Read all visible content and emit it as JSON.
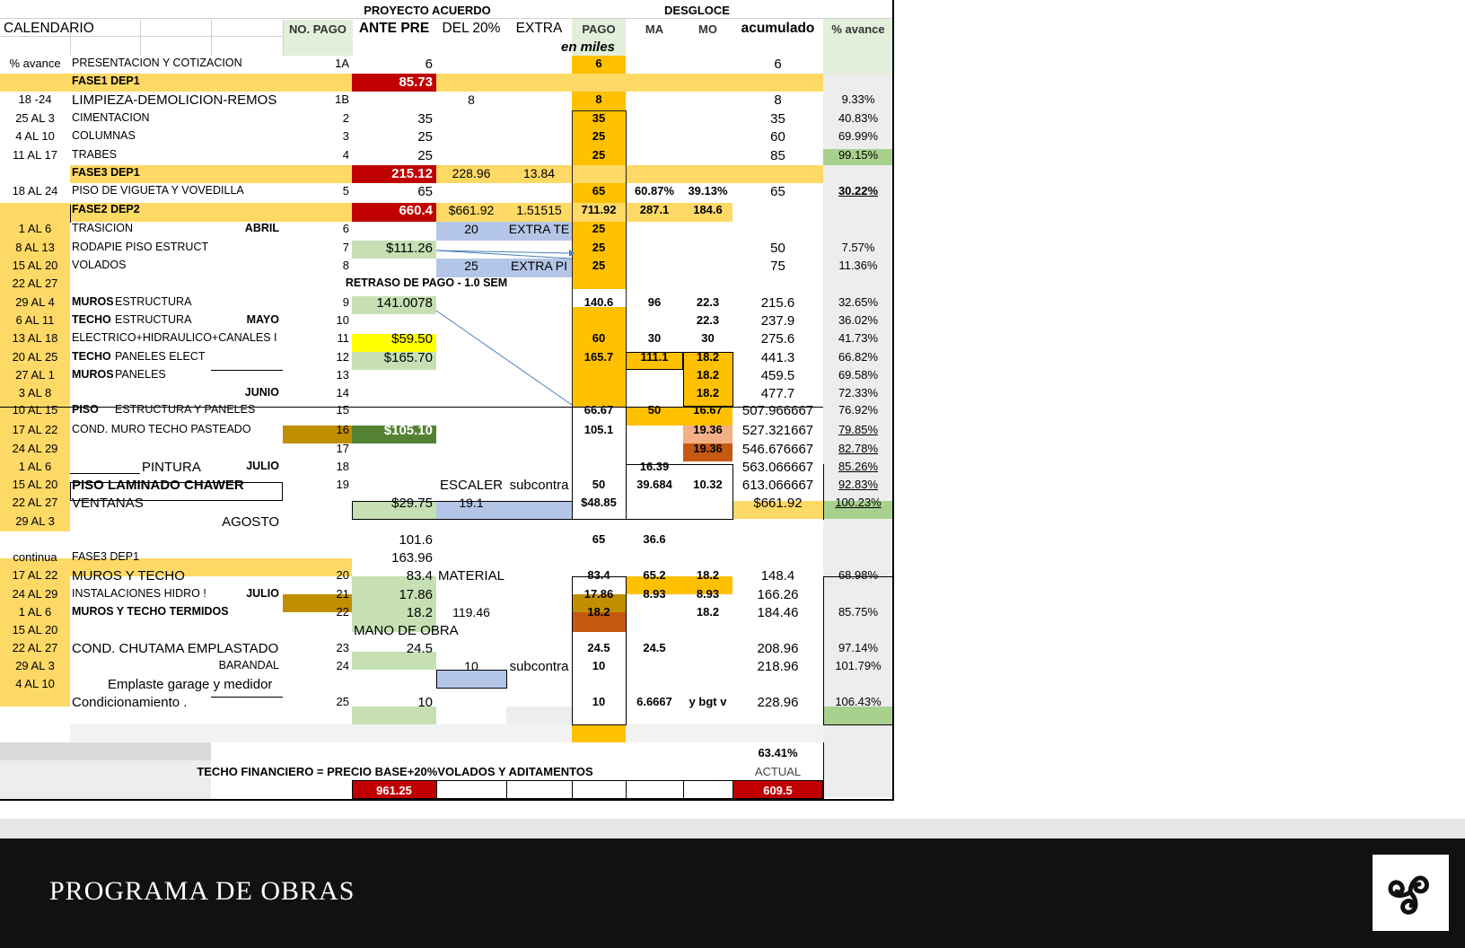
{
  "header": {
    "proyecto_acuerdo": "PROYECTO ACUERDO",
    "desgloce": "DESGLOCE",
    "calendario": "CALENDARIO",
    "no_pago": "NO. PAGO",
    "ante_pre": "ANTE PRE",
    "del_20": "DEL 20%",
    "extra": "EXTRA",
    "pago": "PAGO",
    "ma": "MA",
    "mo": "MO",
    "acumulado": "acumulado",
    "pct_avance": "% avance",
    "en_miles": "en miles",
    "pct_avance_left": "% avance"
  },
  "rows": [
    {
      "cal": "% avance",
      "desc": "PRESENTACION Y COTIZACION",
      "no": "1A",
      "ante": "6",
      "pago": "6",
      "acum": "6"
    },
    {
      "desc": "FASE1 DEP1",
      "ante": "85.73"
    },
    {
      "cal": "18 -24",
      "desc": "LIMPIEZA-DEMOLICION-REMOS",
      "no": "1B",
      "del20": "8",
      "pago": "8",
      "acum": "8",
      "pct": "9.33%"
    },
    {
      "cal": "25 AL 3",
      "desc": "CIMENTACION",
      "no": "2",
      "ante": "35",
      "pago": "35",
      "acum": "35",
      "pct": "40.83%"
    },
    {
      "cal": "4 AL 10",
      "desc": "COLUMNAS",
      "no": "3",
      "ante": "25",
      "pago": "25",
      "acum": "60",
      "pct": "69.99%"
    },
    {
      "cal": "11 AL 17",
      "desc": "TRABES",
      "no": "4",
      "ante": "25",
      "pago": "25",
      "acum": "85",
      "pct": "99.15%"
    },
    {
      "desc": "FASE3 DEP1",
      "ante": "215.12",
      "del20": "228.96",
      "extra": "13.84"
    },
    {
      "cal": "18 AL 24",
      "desc": "PISO DE VIGUETA Y VOVEDILLA",
      "no": "5",
      "ante": "65",
      "pago": "65",
      "ma": "60.87%",
      "mo": "39.13%",
      "acum": "65",
      "pct": "30.22%"
    },
    {
      "desc": "FASE2 DEP2",
      "ante": "660.4",
      "del20": "$661.92",
      "extra": "1.51515",
      "pago": "711.92",
      "ma": "287.1",
      "mo": "184.6"
    },
    {
      "cal": "1 AL 6",
      "desc": "TRASICION",
      "month": "ABRIL",
      "no": "6",
      "del20": "20",
      "extra": "EXTRA TE",
      "pago": "25"
    },
    {
      "cal": "8 AL 13",
      "desc": "RODAPIE PISO ESTRUCT",
      "no": "7",
      "ante": "$111.26",
      "pago": "25",
      "acum": "50",
      "pct": "7.57%"
    },
    {
      "cal": "15 AL 20",
      "desc": "VOLADOS",
      "no": "8",
      "del20": "25",
      "extra": "EXTRA PI",
      "pago": "25",
      "acum": "75",
      "pct": "11.36%"
    },
    {
      "cal": "22 AL 27",
      "desc": "RETRASO DE PAGO - 1.0 SEM"
    },
    {
      "cal": "29 AL 4",
      "desc_b": "MUROS",
      "desc": " ESTRUCTURA",
      "no": "9",
      "ante": "141.0078",
      "pago": "140.6",
      "ma": "96",
      "mo": "22.3",
      "acum": "215.6",
      "pct": "32.65%"
    },
    {
      "cal": "6 AL 11",
      "desc_b": "TECHO",
      "desc": " ESTRUCTURA",
      "month": "MAYO",
      "no": "10",
      "mo": "22.3",
      "acum": "237.9",
      "pct": "36.02%"
    },
    {
      "cal": "13 AL 18",
      "desc": "ELECTRICO+HIDRAULICO+CANALES I",
      "no": "11",
      "ante": "$59.50",
      "pago": "60",
      "ma": "30",
      "mo": "30",
      "acum": "275.6",
      "pct": "41.73%"
    },
    {
      "cal": "20 AL 25",
      "desc_b": "TECHO",
      "desc": " PANELES ELECT",
      "no": "12",
      "ante": "$165.70",
      "pago": "165.7",
      "ma": "111.1",
      "mo": "18.2",
      "acum": "441.3",
      "pct": "66.82%"
    },
    {
      "cal": "27 AL 1",
      "desc_b": "MUROS",
      "desc": " PANELES",
      "no": "13",
      "mo": "18.2",
      "acum": "459.5",
      "pct": "69.58%"
    },
    {
      "cal": "3 AL 8",
      "month": "JUNIO",
      "no": "14",
      "mo": "18.2",
      "acum": "477.7",
      "pct": "72.33%"
    },
    {
      "cal": "10 AL 15",
      "desc_b": "PISO",
      "desc": " ESTRUCTURA Y PANELES",
      "no": "15",
      "pago": "66.67",
      "ma": "50",
      "mo": "16.67",
      "acum": "507.966667",
      "pct": "76.92%"
    },
    {
      "cal": "17 AL 22",
      "desc": "COND. MURO TECHO PASTEADO",
      "no": "16",
      "ante": "$105.10",
      "pago": "105.1",
      "mo": "19.36",
      "acum": "527.321667",
      "pct": "79.85%"
    },
    {
      "cal": "24 AL 29",
      "no": "17",
      "mo": "19.36",
      "acum": "546.676667",
      "pct": "82.78%"
    },
    {
      "cal": "1 AL 6",
      "desc": "PINTURA",
      "month": "JULIO",
      "no": "18",
      "ma": "16.39",
      "acum": "563.066667",
      "pct": "85.26%"
    },
    {
      "cal": "15 AL 20",
      "desc": "PISO LAMINADO CHAWER",
      "no": "19",
      "del20": "ESCALER",
      "extra": "subcontra",
      "pago": "50",
      "ma": "39.684",
      "mo": "10.32",
      "acum": "613.066667",
      "pct": "92.83%"
    },
    {
      "cal": "22 AL 27",
      "desc": "VENTANAS",
      "ante": "$29.75",
      "del20": "19.1",
      "pago": "$48.85",
      "acum": "$661.92",
      "pct": "100.23%"
    },
    {
      "cal": "29 AL 3",
      "month": "AGOSTO"
    },
    {
      "ante": "101.6",
      "pago": "65",
      "ma": "36.6"
    },
    {
      "cal": "continua",
      "desc": "FASE3 DEP1",
      "ante": "163.96"
    },
    {
      "cal": "17 AL 22",
      "desc": "MUROS Y TECHO",
      "no": "20",
      "ante": "83.4",
      "del20": "MATERIAL",
      "pago": "83.4",
      "ma": "65.2",
      "mo": "18.2",
      "acum": "148.4",
      "pct": "68.98%"
    },
    {
      "cal": "24 AL 29",
      "desc": "INSTALACIONES HIDRO !",
      "month": "JULIO",
      "no": "21",
      "ante": "17.86",
      "pago": "17.86",
      "ma": "8.93",
      "mo": "8.93",
      "acum": "166.26"
    },
    {
      "cal": "1 AL 6",
      "desc": "MUROS Y TECHO TERMIDOS",
      "no": "22",
      "ante": "18.2",
      "del20": "119.46",
      "pago": "18.2",
      "mo": "18.2",
      "acum": "184.46",
      "pct": "85.75%"
    },
    {
      "cal": "15 AL 20",
      "ante": "MANO DE OBRA"
    },
    {
      "cal": "22 AL 27",
      "desc": "COND. CHUTAMA  EMPLASTADO",
      "no": "23",
      "ante": "24.5",
      "pago": "24.5",
      "ma": "24.5",
      "acum": "208.96",
      "pct": "97.14%"
    },
    {
      "cal": "29 AL 3",
      "month": "BARANDAL",
      "no": "24",
      "del20": "10",
      "extra": "subcontra",
      "pago": "10",
      "acum": "218.96",
      "pct": "101.79%"
    },
    {
      "cal": "4 AL 10",
      "desc": "Emplaste garage y medidor"
    },
    {
      "desc": "Condicionamiento .",
      "no": "25",
      "ante": "10",
      "pago": "10",
      "ma": "6.6667",
      "mo": "y bgt v",
      "acum": "228.96",
      "pct": "106.43%"
    }
  ],
  "summary": {
    "pct": "63.41%",
    "techo_financiero": "TECHO FINANCIERO = PRECIO BASE+20%VOLADOS Y ADITAMENTOS",
    "actual_label": "ACTUAL",
    "total_ante": "961.25",
    "actual_value": "609.5"
  },
  "footer": {
    "title": "PROGRAMA DE OBRAS",
    "logo_icon": "triskelion-icon"
  },
  "colors": {
    "orange": "#ffc000",
    "light_orange": "#ffd966",
    "red": "#c00000",
    "light_green": "#c6e0b4",
    "green_highlight": "#a9d18e",
    "dark_green": "#548235",
    "yellow": "#ffff00",
    "blue": "#b4c6e7",
    "brown": "#bf8f00",
    "dark_orange": "#c65911",
    "footer_bg": "#111111"
  }
}
